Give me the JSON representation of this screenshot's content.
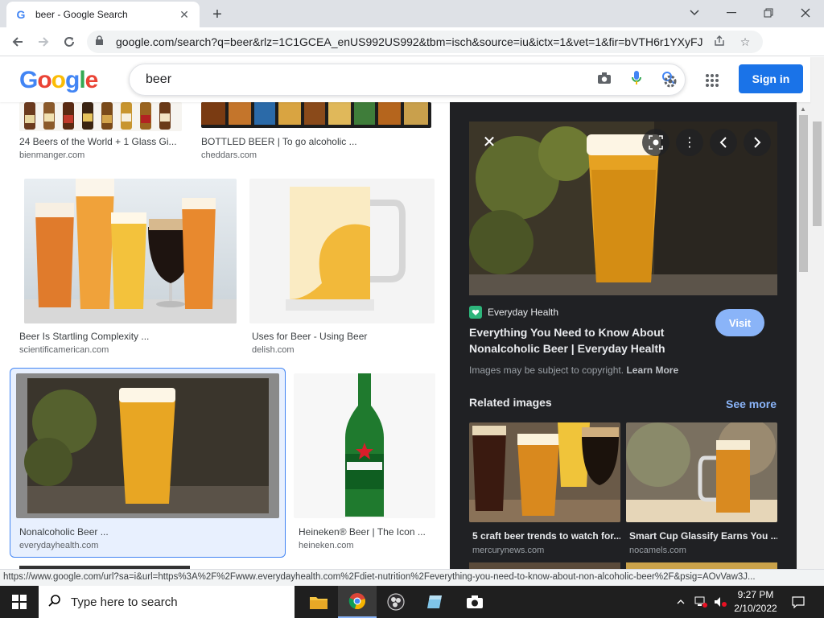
{
  "browser": {
    "tab_title": "beer - Google Search",
    "tab_favicon": "G",
    "new_tab_symbol": "+",
    "url": "google.com/search?q=beer&rlz=1C1GCEA_enUS992US992&tbm=isch&source=iu&ictx=1&vet=1&fir=bVTH6r1YXyFJ...",
    "status_url": "https://www.google.com/url?sa=i&url=https%3A%2F%2Fwww.everydayhealth.com%2Fdiet-nutrition%2Feverything-you-need-to-know-about-non-alcoholic-beer%2F&psig=AOvVaw3J..."
  },
  "google": {
    "logo_letters": [
      "G",
      "o",
      "o",
      "g",
      "l",
      "e"
    ],
    "logo_colors": [
      "#4285F4",
      "#EA4335",
      "#FBBC05",
      "#4285F4",
      "#34A853",
      "#EA4335"
    ],
    "query": "beer",
    "sign_in": "Sign in"
  },
  "results": [
    {
      "caption": "24 Beers of the World + 1 Glass Gi...",
      "source": "bienmanger.com"
    },
    {
      "caption": "BOTTLED BEER | To go alcoholic ...",
      "source": "cheddars.com"
    },
    {
      "caption": "Beer Is Startling Complexity ...",
      "source": "scientificamerican.com"
    },
    {
      "caption": "Uses for Beer - Using Beer",
      "source": "delish.com"
    },
    {
      "caption": "Nonalcoholic Beer ...",
      "source": "everydayhealth.com"
    },
    {
      "caption": "Heineken® Beer | The Icon ...",
      "source": "heineken.com"
    }
  ],
  "preview": {
    "site": "Everyday Health",
    "title": "Everything You Need to Know About Nonalcoholic Beer | Everyday Health",
    "visit": "Visit",
    "copyright": "Images may be subject to copyright.",
    "learn_more": "Learn More",
    "related_heading": "Related images",
    "see_more": "See more",
    "related": [
      {
        "caption": "5 craft beer trends to watch for...",
        "source": "mercurynews.com"
      },
      {
        "caption": "Smart Cup Glassify Earns You ...",
        "source": "nocamels.com"
      }
    ]
  },
  "taskbar": {
    "search_placeholder": "Type here to search",
    "time": "9:27 PM",
    "date": "2/10/2022"
  }
}
